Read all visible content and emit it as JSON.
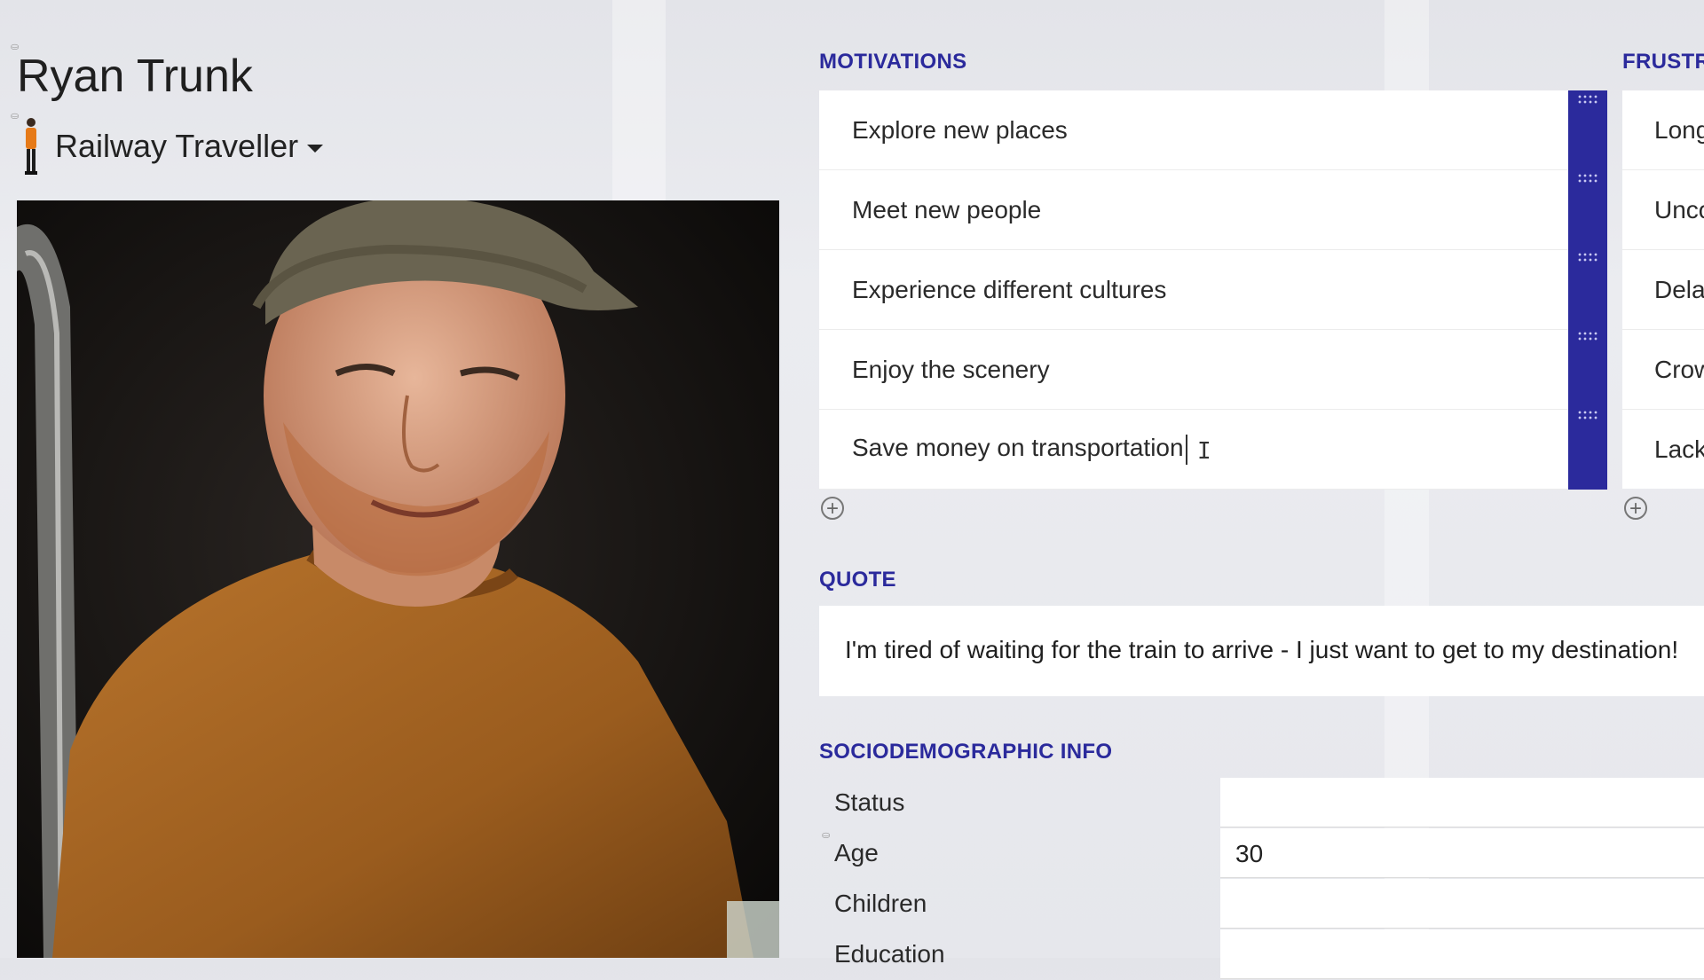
{
  "persona": {
    "name": "Ryan Trunk",
    "role": "Railway Traveller",
    "role_icon": "person-figure-icon"
  },
  "motivations": {
    "heading": "MOTIVATIONS",
    "items": [
      "Explore new places",
      "Meet new people",
      "Experience different cultures",
      "Enjoy the scenery",
      "Save money on transportation"
    ],
    "add_icon": "plus-circle-icon",
    "accent": "#2b2a9c"
  },
  "frustrations": {
    "heading": "FRUSTR",
    "items": [
      "Long",
      "Unco",
      "Dela",
      "Crow",
      "Lack"
    ]
  },
  "quote": {
    "heading": "QUOTE",
    "text": "I'm tired of waiting for the train to arrive - I just want to get to my destination!"
  },
  "sociodemographic": {
    "heading": "SOCIODEMOGRAPHIC INFO",
    "rows": [
      {
        "label": "Status",
        "value": ""
      },
      {
        "label": "Age",
        "value": "30"
      },
      {
        "label": "Children",
        "value": ""
      },
      {
        "label": "Education",
        "value": ""
      }
    ]
  }
}
